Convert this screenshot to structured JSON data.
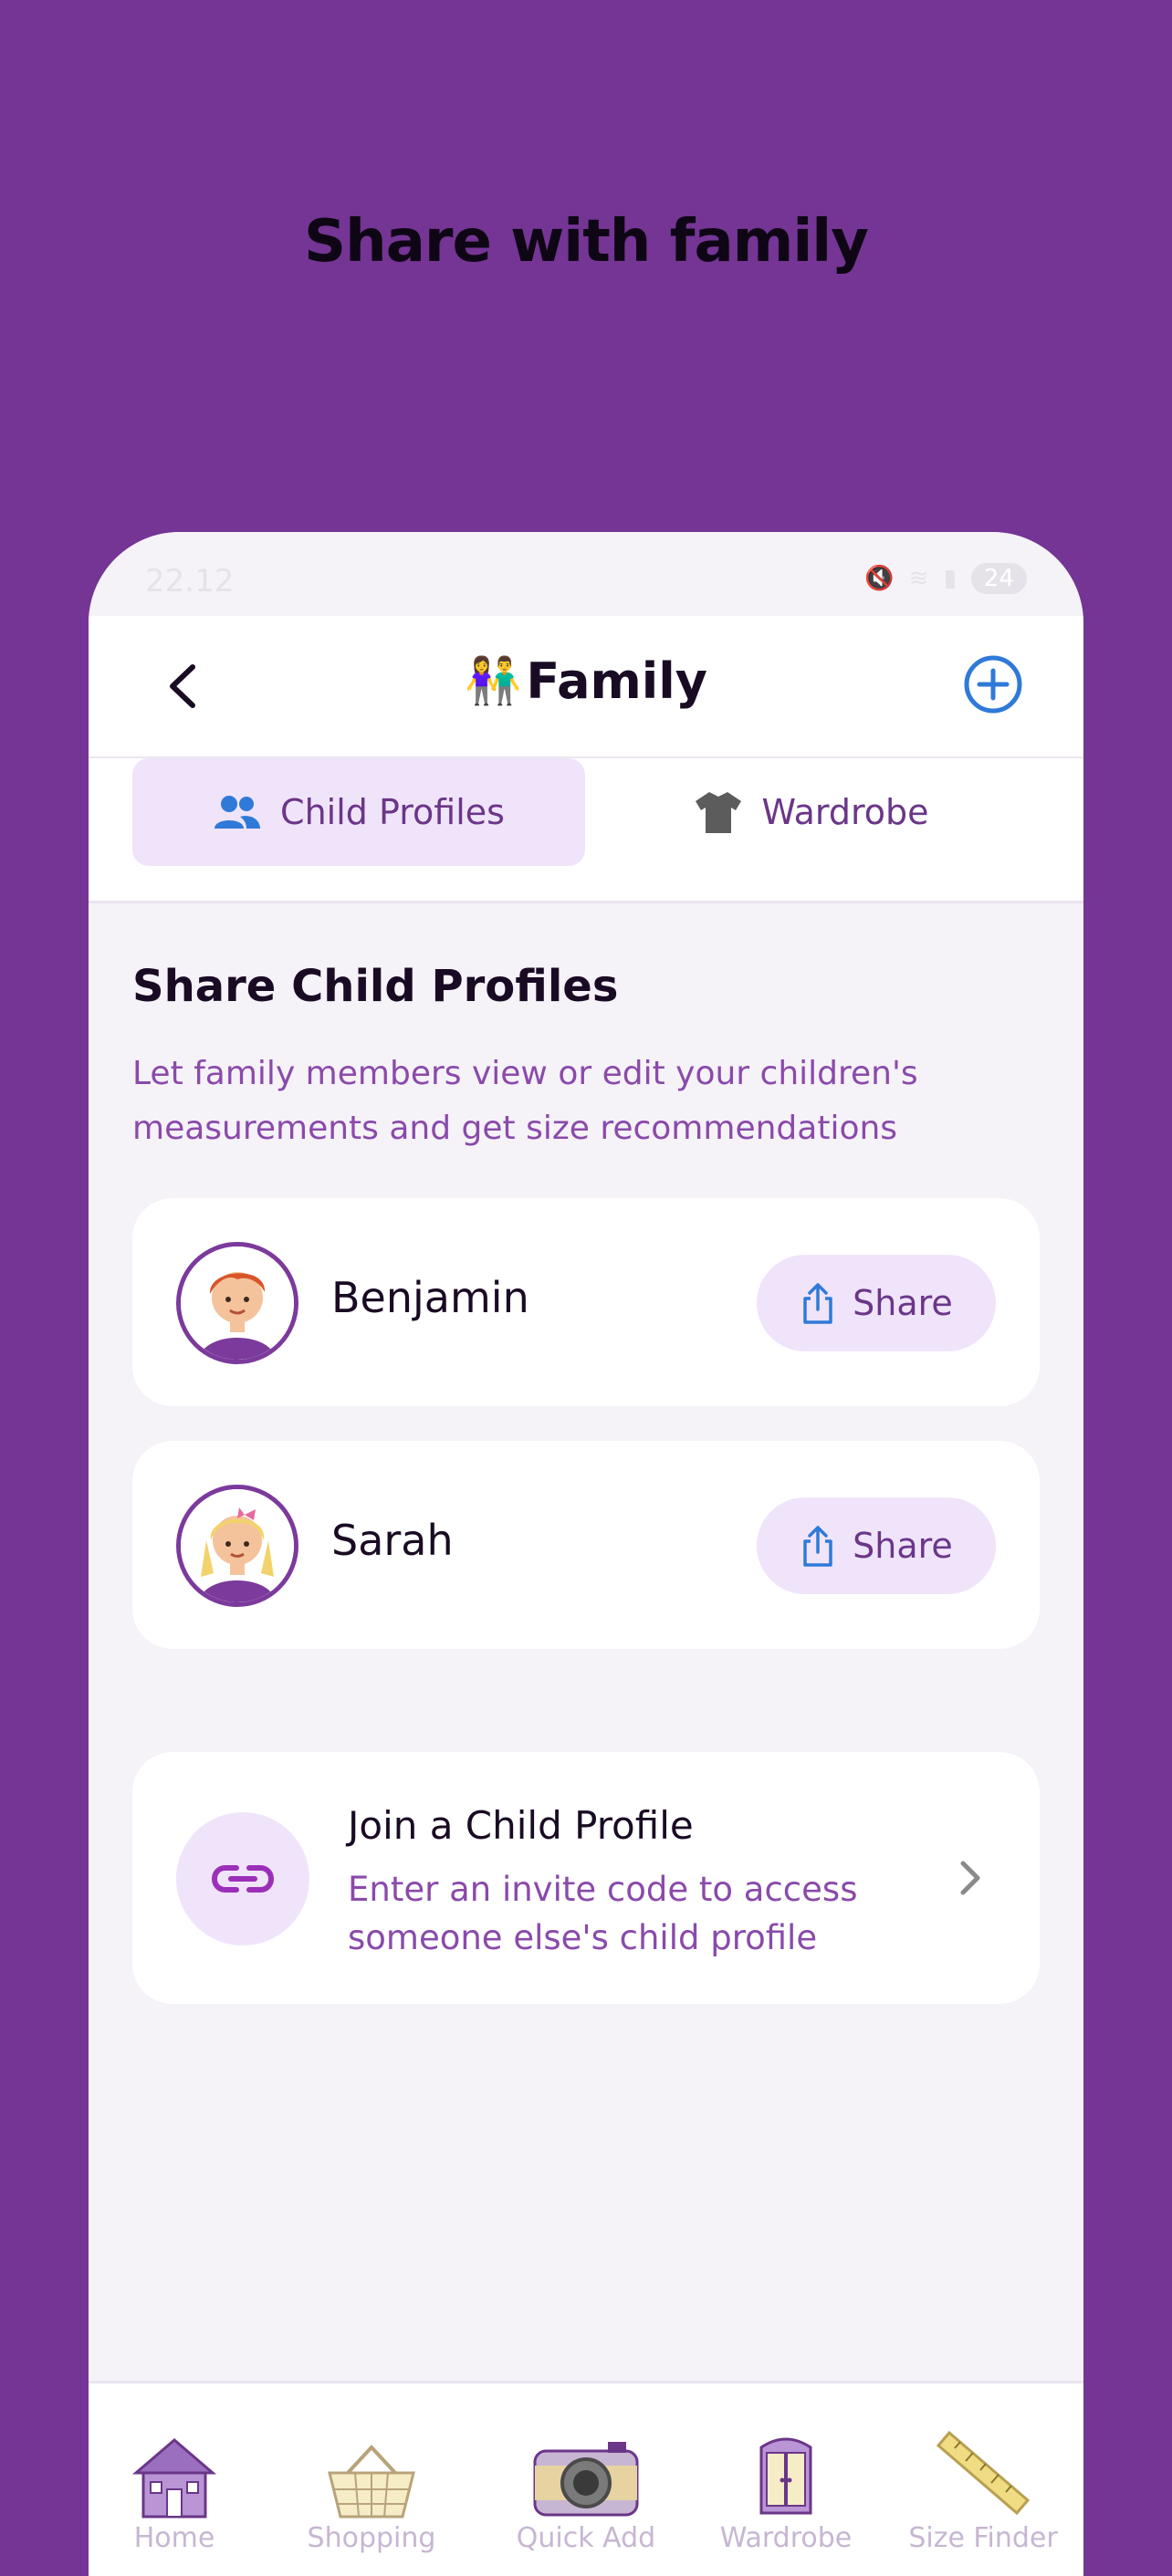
{
  "headline": "Share with family",
  "status": {
    "time": "22.12",
    "battery": "24"
  },
  "appbar": {
    "emoji": "👫",
    "title": "Family"
  },
  "tabs": [
    {
      "label": "Child Profiles",
      "icon": "people-icon",
      "active": true
    },
    {
      "label": "Wardrobe",
      "icon": "tshirt-icon",
      "active": false
    }
  ],
  "section": {
    "title": "Share Child Profiles",
    "description": "Let family members view or edit your children's measurements and get size recommendations"
  },
  "children": [
    {
      "name": "Benjamin",
      "share_label": "Share"
    },
    {
      "name": "Sarah",
      "share_label": "Share"
    }
  ],
  "join": {
    "title": "Join a Child Profile",
    "description": "Enter an invite code to access someone else's child profile"
  },
  "bottom_nav": [
    {
      "label": "Home",
      "icon": "house-icon"
    },
    {
      "label": "Shopping",
      "icon": "basket-icon"
    },
    {
      "label": "Quick Add",
      "icon": "camera-icon"
    },
    {
      "label": "Wardrobe",
      "icon": "wardrobe-icon"
    },
    {
      "label": "Size Finder",
      "icon": "ruler-icon"
    }
  ],
  "colors": {
    "background": "#743594",
    "accent": "#6b3688",
    "active_tab": "#f0e4fb",
    "add_button": "#2f7ad8"
  }
}
